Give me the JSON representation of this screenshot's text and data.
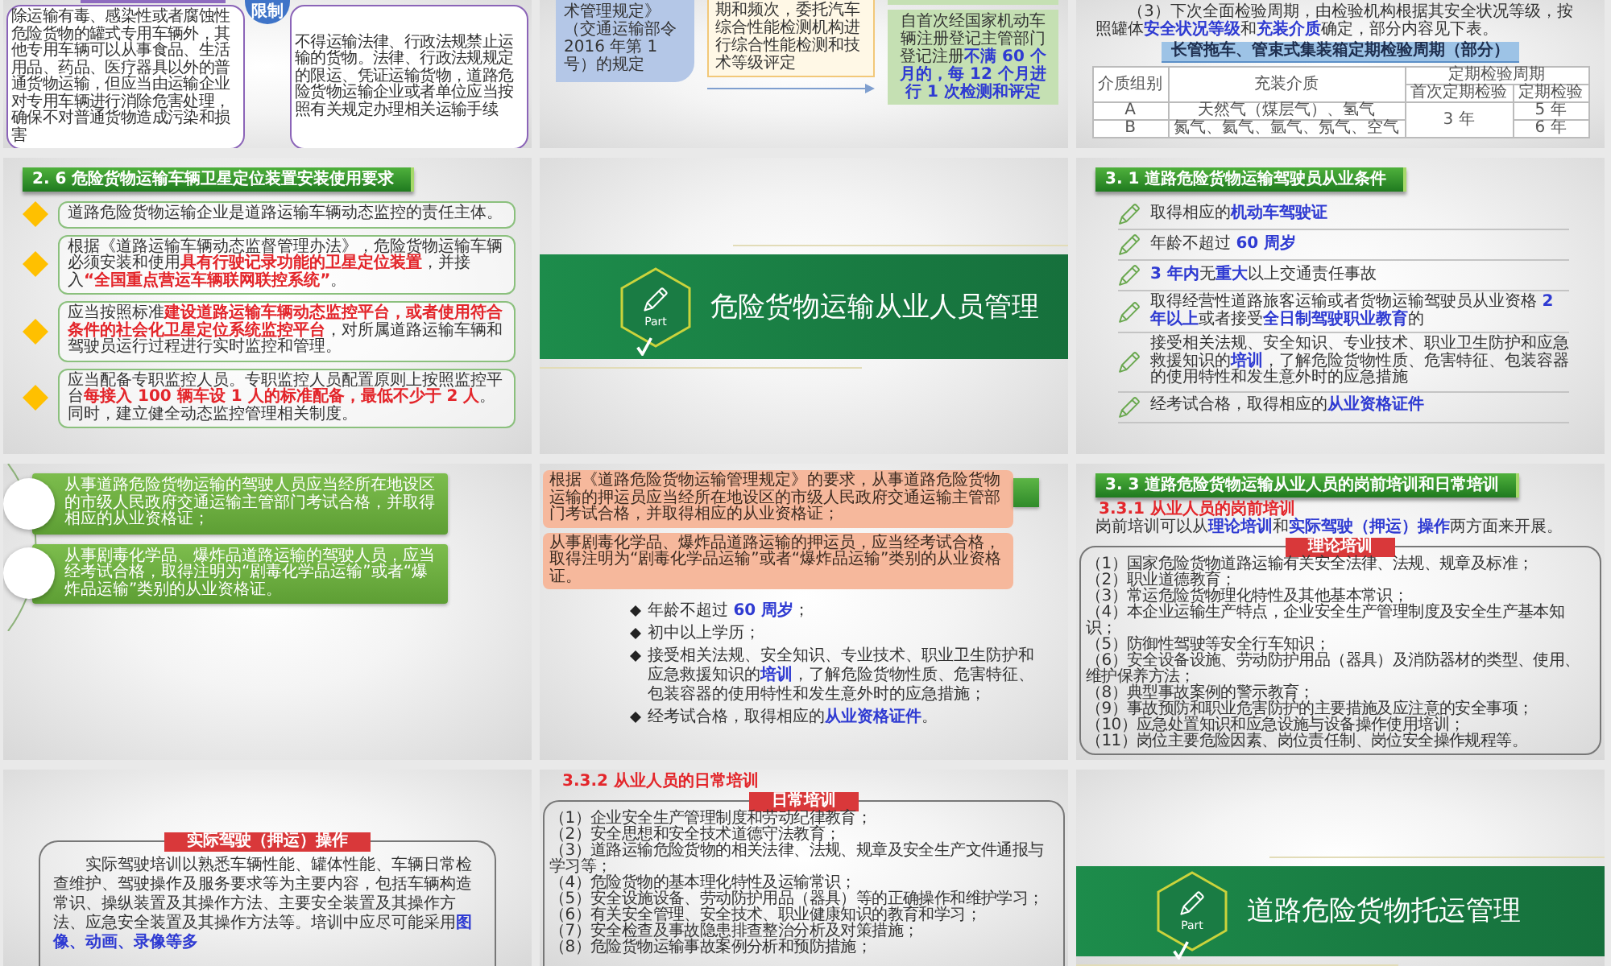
{
  "slides": [
    {
      "kind": "comparison",
      "badge": "限制",
      "boxes": [
        "除运输有毒、感染性或者腐蚀性危险货物的罐式专用车辆外，其他专用车辆可以从事食品、生活用品、药品、医疗器具以外的普通货物运输，但应当由运输企业对专用车辆进行消除危害处理，确保不对普通货物造成污染和损害",
        "不得运输法律、行政法规禁止运输的货物。法律、行政法规规定的限运、凭证运输货物，道路危险货物运输企业或者单位应当按照有关规定办理相关运输手续"
      ]
    },
    {
      "kind": "flow",
      "source": "术管理规定》（交通运输部令 2016 年第 1 号）的规定",
      "process": "期和频次，委托汽车综合性能检测机构进行综合性能检测和技术等级评定",
      "result": "自首次经国家机动车辆注册登记主管部门登记注册**不满 60 个月的，每 12 个月进行 1 次检测和评定**"
    },
    {
      "kind": "table",
      "paragraph": "（3）下次全面检验周期，由检验机构根据其安全状况等级，按照罐体**安全状况等级**和**充装介质**确定，部分内容见下表。",
      "table_title": "长管拖车、管束式集装箱定期检验周期（部分）",
      "table": {
        "columns": [
          "介质组别",
          "充装介质"
        ],
        "group_heading": "定期检验周期",
        "group_columns": [
          "首次定期检验",
          "定期检验"
        ],
        "first_period": "3 年",
        "rows": [
          {
            "grade": "A",
            "medium": "天然气（煤层气）、氢气",
            "period": "5 年"
          },
          {
            "grade": "B",
            "medium": "氮气、氦气、氩气、氖气、空气",
            "period": "6 年"
          }
        ]
      }
    },
    {
      "kind": "diamond-list",
      "title": "2. 6 危险货物运输车辆卫星定位装置安装使用要求",
      "items": [
        "道路危险货物运输企业是道路运输车辆动态监控的责任主体。",
        "根据《道路运输车辆动态监督管理办法》，危险货物运输车辆必须安装和使用**具有行驶记录功能的卫星定位装置**，并接入**“全国重点营运车辆联网联控系统”**。",
        "应当按照标准**建设道路运输车辆动态监控平台，或者使用符合条件的社会化卫星定位系统监控平台**，对所属道路运输车辆和驾驶员运行过程进行实时监控和管理。",
        "应当配备专职监控人员。专职监控人员配置原则上按照监控平台**每接入 100 辆车设 1 人的标准配备，最低不少于 2 人**。同时，建立健全动态监控管理相关制度。"
      ]
    },
    {
      "kind": "part",
      "label": "Part",
      "title": "危险货物运输从业人员管理"
    },
    {
      "kind": "pencil-list",
      "title": "3. 1 道路危险货物运输驾驶员从业条件",
      "items": [
        "取得相应的**机动车驾驶证**",
        "年龄不超过 **60 周岁**",
        "**3 年内**无**重大**以上交通责任事故",
        "取得经营性道路旅客运输或者货物运输驾驶员从业资格 **2 年以上**或者接受**全日制驾驶职业教育**的",
        "接受相关法规、安全知识、专业技术、职业卫生防护和应急救援知识的**培训**，了解危险货物性质、危害特征、包装容器的使用特性和发生意外时的应急措施",
        "经考试合格，取得相应的**从业资格证件**"
      ]
    },
    {
      "kind": "circle-bars",
      "items": [
        "从事道路危险货物运输的驾驶人员应当经所在地设区的市级人民政府交通运输主管部门考试合格，并取得相应的从业资格证；",
        "从事剧毒化学品、爆炸品道路运输的驾驶人员，应当经考试合格，取得注明为“剧毒化学品运输”或者“爆炸品运输”类别的从业资格证。"
      ]
    },
    {
      "kind": "notes-bullets",
      "notes": [
        "根据《道路危险货物运输管理规定》的要求，从事道路危险货物运输的押运员应当经所在地设区的市级人民政府交通运输主管部门考试合格，并取得相应的从业资格证；",
        "从事剧毒化学品、爆炸品道路运输的押运员，应当经考试合格，取得注明为“剧毒化学品运输”或者“爆炸品运输”类别的从业资格证。"
      ],
      "bullets": [
        "年龄不超过 **60 周岁**；",
        "初中以上学历；",
        "接受相关法规、安全知识、专业技术、职业卫生防护和应急救援知识的**培训**，了解危险货物性质、危害特征、包装容器的使用特性和发生意外时的应急措施；",
        "经考试合格，取得相应的**从业资格证件**。"
      ]
    },
    {
      "kind": "training",
      "title": "3. 3 道路危险货物运输从业人员的岗前培训和日常培训",
      "subheading": "3.3.1 从业人员的岗前培训",
      "intro": "岗前培训可以从**理论培训**和**实际驾驶（押运）操作**两方面来开展。",
      "tab": "理论培训",
      "items": [
        "（1）国家危险货物道路运输有关安全法律、法规、规章及标准；",
        "（2）职业道德教育；",
        "（3）常运危险货物理化特性及其他基本常识；",
        "（4）本企业运输生产特点，企业安全生产管理制度及安全生产基本知识；",
        "（5）防御性驾驶等安全行车知识；",
        "（6）安全设备设施、劳动防护用品（器具）及消防器材的类型、使用、维护保养方法；",
        "（8）典型事故案例的警示教育；",
        "（9）事故预防和职业危害防护的主要措施及应注意的安全事项；",
        "（10）应急处置知识和应急设施与设备操作使用培训；",
        "（11）岗位主要危险因素、岗位责任制、岗位安全操作规程等。"
      ]
    },
    {
      "kind": "practice",
      "tab": "实际驾驶（押运）操作",
      "paragraph": "实际驾驶培训以熟悉车辆性能、罐体性能、车辆日常检查维护、驾驶操作及服务要求等为主要内容，包括车辆构造常识、操纵装置及其操作方法、主要安全装置及其操作方法、应急安全装置及其操作方法等。培训中应尽可能采用**图像、动画、录像等多**"
    },
    {
      "kind": "training",
      "subheading": "3.3.2 从业人员的日常培训",
      "tab": "日常培训",
      "items": [
        "（1）企业安全生产管理制度和劳动纪律教育；",
        "（2）安全思想和安全技术道德守法教育；",
        "（3）道路运输危险货物的相关法律、法规、规章及安全生产文件通报与学习等；",
        "（4）危险货物的基本理化特性及运输常识；",
        "（5）安全设施设备、劳动防护用品（器具）等的正确操作和维护学习；",
        "（6）有关安全管理、安全技术、职业健康知识的教育和学习；",
        "（7）安全检查及事故隐患排查整治分析及对策措施；",
        "（8）危险货物运输事故案例分析和预防措施；"
      ]
    },
    {
      "kind": "part",
      "label": "Part",
      "title": "道路危险货物托运管理"
    }
  ]
}
